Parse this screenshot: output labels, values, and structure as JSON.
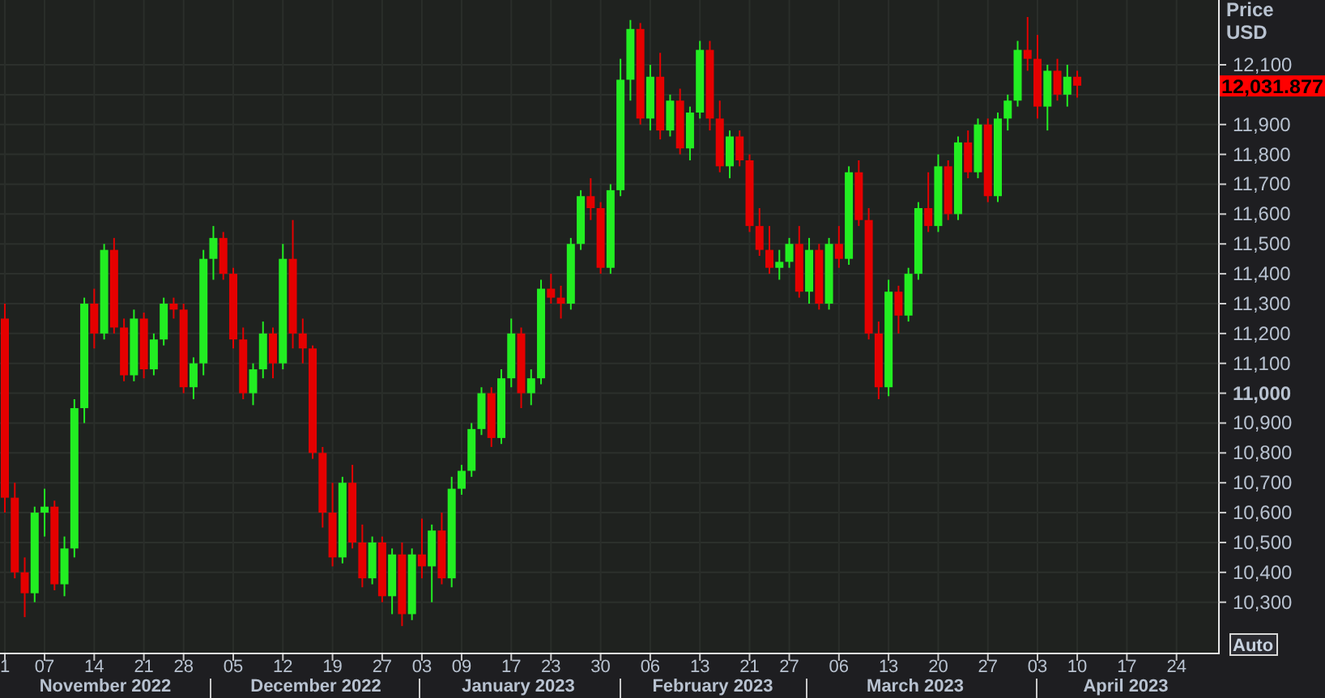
{
  "y_axis": {
    "title": [
      "Price",
      "USD"
    ],
    "tick_styles": [
      {
        "major": false
      },
      {
        "major": false
      },
      {
        "major": false
      },
      {
        "major": false
      },
      {
        "major": false
      },
      {
        "major": false
      },
      {
        "major": false
      },
      {
        "major": false
      },
      {
        "major": false
      },
      {
        "major": false
      },
      {
        "major": true
      },
      {
        "major": false
      },
      {
        "major": false
      },
      {
        "major": false
      },
      {
        "major": false
      },
      {
        "major": false
      },
      {
        "major": false
      },
      {
        "major": false
      }
    ],
    "current_price": "12,031.877"
  },
  "auto_button": "Auto",
  "x_axis": {
    "months": [
      "November 2022",
      "December 2022",
      "January 2023",
      "February 2023",
      "March 2023",
      "April 2023"
    ]
  },
  "chart_data": {
    "type": "candlestick",
    "grid": true,
    "ylim": [
      10131,
      12317
    ],
    "yticks": [
      {
        "value": 12100,
        "label": "12,100"
      },
      {
        "value": 11900,
        "label": "11,900"
      },
      {
        "value": 11800,
        "label": "11,800"
      },
      {
        "value": 11700,
        "label": "11,700"
      },
      {
        "value": 11600,
        "label": "11,600"
      },
      {
        "value": 11500,
        "label": "11,500"
      },
      {
        "value": 11400,
        "label": "11,400"
      },
      {
        "value": 11300,
        "label": "11,300"
      },
      {
        "value": 11200,
        "label": "11,200"
      },
      {
        "value": 11100,
        "label": "11,100"
      },
      {
        "value": 11000,
        "label": "11,000"
      },
      {
        "value": 10900,
        "label": "10,900"
      },
      {
        "value": 10800,
        "label": "10,800"
      },
      {
        "value": 10700,
        "label": "10,700"
      },
      {
        "value": 10600,
        "label": "10,600"
      },
      {
        "value": 10500,
        "label": "10,500"
      },
      {
        "value": 10400,
        "label": "10,400"
      },
      {
        "value": 10300,
        "label": "10,300"
      }
    ],
    "categories": [
      "1",
      null,
      null,
      null,
      "07",
      null,
      null,
      null,
      null,
      "14",
      null,
      null,
      null,
      null,
      "21",
      null,
      null,
      null,
      "28",
      null,
      null,
      null,
      null,
      "05",
      null,
      null,
      null,
      null,
      "12",
      null,
      null,
      null,
      null,
      "19",
      null,
      null,
      null,
      null,
      "27",
      null,
      null,
      null,
      "03",
      null,
      null,
      null,
      "09",
      null,
      null,
      null,
      null,
      "17",
      null,
      null,
      null,
      "23",
      null,
      null,
      null,
      null,
      "30",
      null,
      null,
      null,
      null,
      "06",
      null,
      null,
      null,
      null,
      "13",
      null,
      null,
      null,
      null,
      "21",
      null,
      null,
      null,
      "27",
      null,
      null,
      null,
      null,
      "06",
      null,
      null,
      null,
      null,
      "13",
      null,
      null,
      null,
      null,
      "20",
      null,
      null,
      null,
      null,
      "27",
      null,
      null,
      null,
      null,
      "03",
      null,
      null,
      null,
      "10",
      null,
      null,
      null,
      null,
      "17",
      null,
      null,
      null,
      null,
      "24",
      null,
      null,
      null,
      null
    ],
    "ohlc": [
      [
        11250,
        11300,
        10600,
        10650
      ],
      [
        10650,
        10700,
        10380,
        10400
      ],
      [
        10400,
        10450,
        10250,
        10330
      ],
      [
        10330,
        10620,
        10300,
        10600
      ],
      [
        10600,
        10680,
        10520,
        10620
      ],
      [
        10620,
        10640,
        10340,
        10360
      ],
      [
        10360,
        10520,
        10320,
        10480
      ],
      [
        10480,
        10980,
        10450,
        10950
      ],
      [
        10950,
        11320,
        10900,
        11300
      ],
      [
        11300,
        11350,
        11150,
        11200
      ],
      [
        11200,
        11500,
        11180,
        11480
      ],
      [
        11480,
        11520,
        11200,
        11220
      ],
      [
        11220,
        11250,
        11040,
        11060
      ],
      [
        11060,
        11280,
        11040,
        11250
      ],
      [
        11250,
        11270,
        11050,
        11080
      ],
      [
        11080,
        11200,
        11060,
        11180
      ],
      [
        11180,
        11320,
        11160,
        11300
      ],
      [
        11300,
        11320,
        11250,
        11280
      ],
      [
        11280,
        11300,
        11000,
        11020
      ],
      [
        11020,
        11120,
        10980,
        11100
      ],
      [
        11100,
        11480,
        11060,
        11450
      ],
      [
        11450,
        11560,
        11380,
        11520
      ],
      [
        11520,
        11540,
        11380,
        11400
      ],
      [
        11400,
        11420,
        11150,
        11180
      ],
      [
        11180,
        11220,
        10980,
        11000
      ],
      [
        11000,
        11100,
        10960,
        11080
      ],
      [
        11080,
        11240,
        11050,
        11200
      ],
      [
        11200,
        11220,
        11050,
        11100
      ],
      [
        11100,
        11500,
        11080,
        11450
      ],
      [
        11450,
        11580,
        11150,
        11200
      ],
      [
        11200,
        11250,
        11100,
        11150
      ],
      [
        11150,
        11160,
        10780,
        10800
      ],
      [
        10800,
        10820,
        10550,
        10600
      ],
      [
        10600,
        10700,
        10420,
        10450
      ],
      [
        10450,
        10720,
        10430,
        10700
      ],
      [
        10700,
        10760,
        10480,
        10500
      ],
      [
        10500,
        10560,
        10350,
        10380
      ],
      [
        10380,
        10520,
        10360,
        10500
      ],
      [
        10500,
        10520,
        10300,
        10320
      ],
      [
        10320,
        10480,
        10260,
        10460
      ],
      [
        10460,
        10500,
        10220,
        10260
      ],
      [
        10260,
        10480,
        10240,
        10460
      ],
      [
        10460,
        10580,
        10380,
        10420
      ],
      [
        10420,
        10560,
        10300,
        10540
      ],
      [
        10540,
        10600,
        10360,
        10380
      ],
      [
        10380,
        10720,
        10350,
        10680
      ],
      [
        10680,
        10760,
        10660,
        10740
      ],
      [
        10740,
        10900,
        10720,
        10880
      ],
      [
        10880,
        11020,
        10860,
        11000
      ],
      [
        11000,
        11020,
        10820,
        10850
      ],
      [
        10850,
        11080,
        10830,
        11050
      ],
      [
        11050,
        11250,
        11020,
        11200
      ],
      [
        11200,
        11220,
        10950,
        11000
      ],
      [
        11000,
        11080,
        10960,
        11050
      ],
      [
        11050,
        11380,
        11030,
        11350
      ],
      [
        11350,
        11400,
        11300,
        11320
      ],
      [
        11320,
        11360,
        11250,
        11300
      ],
      [
        11300,
        11520,
        11280,
        11500
      ],
      [
        11500,
        11680,
        11480,
        11660
      ],
      [
        11660,
        11720,
        11580,
        11620
      ],
      [
        11620,
        11640,
        11400,
        11420
      ],
      [
        11420,
        11700,
        11400,
        11680
      ],
      [
        11680,
        12120,
        11660,
        12050
      ],
      [
        12050,
        12250,
        11980,
        12220
      ],
      [
        12220,
        12240,
        11900,
        11920
      ],
      [
        11920,
        12100,
        11880,
        12060
      ],
      [
        12060,
        12140,
        11850,
        11880
      ],
      [
        11880,
        12000,
        11860,
        11980
      ],
      [
        11980,
        12020,
        11800,
        11820
      ],
      [
        11820,
        11960,
        11780,
        11940
      ],
      [
        11940,
        12180,
        11920,
        12150
      ],
      [
        12150,
        12180,
        11880,
        11920
      ],
      [
        11920,
        11980,
        11740,
        11760
      ],
      [
        11760,
        11880,
        11720,
        11860
      ],
      [
        11860,
        11880,
        11760,
        11780
      ],
      [
        11780,
        11800,
        11540,
        11560
      ],
      [
        11560,
        11620,
        11460,
        11480
      ],
      [
        11480,
        11560,
        11400,
        11420
      ],
      [
        11420,
        11480,
        11380,
        11440
      ],
      [
        11440,
        11520,
        11420,
        11500
      ],
      [
        11500,
        11560,
        11320,
        11340
      ],
      [
        11340,
        11520,
        11300,
        11480
      ],
      [
        11480,
        11500,
        11280,
        11300
      ],
      [
        11300,
        11520,
        11280,
        11500
      ],
      [
        11500,
        11560,
        11420,
        11450
      ],
      [
        11450,
        11760,
        11430,
        11740
      ],
      [
        11740,
        11780,
        11560,
        11580
      ],
      [
        11580,
        11620,
        11180,
        11200
      ],
      [
        11200,
        11240,
        10980,
        11020
      ],
      [
        11020,
        11380,
        10990,
        11340
      ],
      [
        11340,
        11360,
        11200,
        11260
      ],
      [
        11260,
        11420,
        11240,
        11400
      ],
      [
        11400,
        11640,
        11380,
        11620
      ],
      [
        11620,
        11740,
        11540,
        11560
      ],
      [
        11560,
        11800,
        11540,
        11760
      ],
      [
        11760,
        11780,
        11580,
        11600
      ],
      [
        11600,
        11860,
        11580,
        11840
      ],
      [
        11840,
        11880,
        11720,
        11740
      ],
      [
        11740,
        11920,
        11720,
        11900
      ],
      [
        11900,
        11920,
        11640,
        11660
      ],
      [
        11660,
        11940,
        11640,
        11920
      ],
      [
        11920,
        12000,
        11880,
        11980
      ],
      [
        11980,
        12180,
        11960,
        12150
      ],
      [
        12150,
        12260,
        12080,
        12120
      ],
      [
        12120,
        12200,
        11920,
        11960
      ],
      [
        11960,
        12100,
        11880,
        12080
      ],
      [
        12080,
        12120,
        11980,
        12000
      ],
      [
        12000,
        12100,
        11960,
        12060
      ],
      [
        12060,
        12080,
        11990,
        12030
      ],
      null,
      null,
      null,
      null,
      null,
      null,
      null,
      null,
      null,
      null,
      null,
      null,
      null,
      null
    ]
  }
}
